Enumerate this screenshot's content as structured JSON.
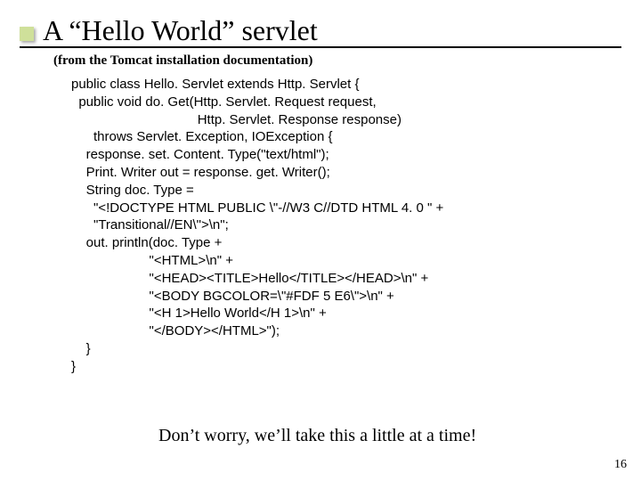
{
  "title": "A “Hello World” servlet",
  "subtitle": "(from the Tomcat installation documentation)",
  "code": "public class Hello. Servlet extends Http. Servlet {\n  public void do. Get(Http. Servlet. Request request,\n                                  Http. Servlet. Response response)\n      throws Servlet. Exception, IOException {\n    response. set. Content. Type(\"text/html\");\n    Print. Writer out = response. get. Writer();\n    String doc. Type =\n      \"<!DOCTYPE HTML PUBLIC \\\"-//W3 C//DTD HTML 4. 0 \" +\n      \"Transitional//EN\\\">\\n\";\n    out. println(doc. Type +\n                     \"<HTML>\\n\" +\n                     \"<HEAD><TITLE>Hello</TITLE></HEAD>\\n\" +\n                     \"<BODY BGCOLOR=\\\"#FDF 5 E6\\\">\\n\" +\n                     \"<H 1>Hello World</H 1>\\n\" +\n                     \"</BODY></HTML>\");\n    }\n}",
  "footnote": "Don’t worry, we’ll take this a little at a time!",
  "page_number": "16"
}
